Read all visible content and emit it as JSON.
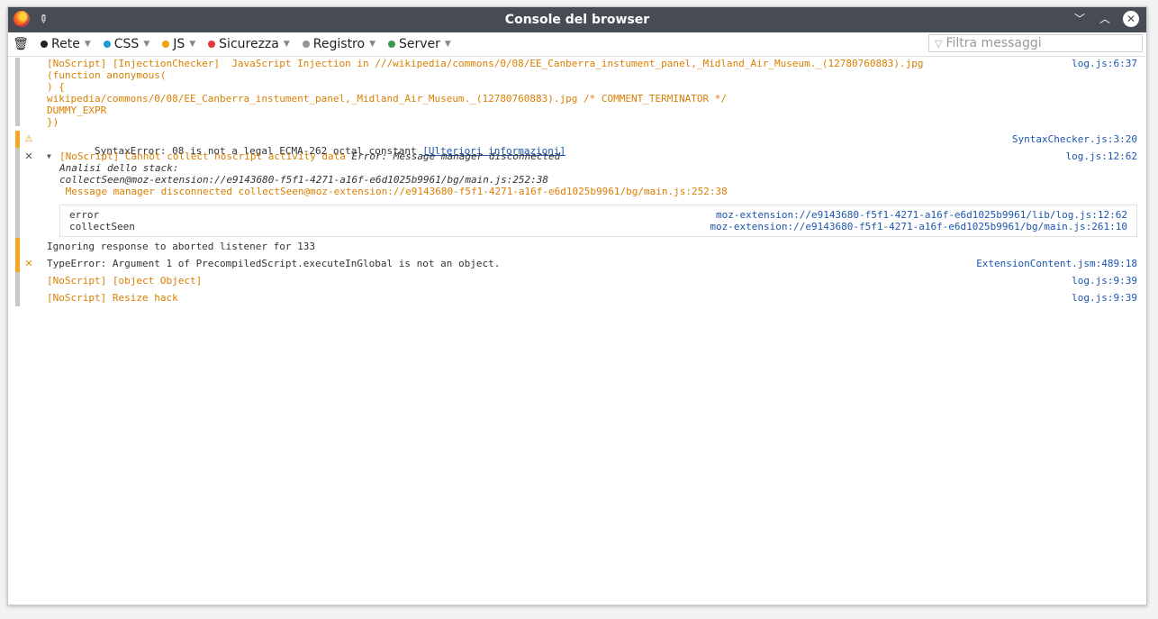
{
  "window": {
    "title": "Console del browser"
  },
  "toolbar": {
    "filters": [
      {
        "label": "Rete",
        "color": "#222222"
      },
      {
        "label": "CSS",
        "color": "#1e9bd7"
      },
      {
        "label": "JS",
        "color": "#f0a30a"
      },
      {
        "label": "Sicurezza",
        "color": "#e0383e"
      },
      {
        "label": "Registro",
        "color": "#8f969a"
      },
      {
        "label": "Server",
        "color": "#3a9b48"
      }
    ],
    "filter_placeholder": "Filtra messaggi"
  },
  "messages": {
    "m1": {
      "lines": [
        "[NoScript] [InjectionChecker]  JavaScript Injection in ///wikipedia/commons/0/08/EE_Canberra_instument_panel,_Midland_Air_Museum._(12780760883).jpg",
        "(function anonymous(",
        ") {",
        "wikipedia/commons/0/08/EE_Canberra_instument_panel,_Midland_Air_Museum._(12780760883).jpg /* COMMENT_TERMINATOR */",
        "DUMMY_EXPR",
        "})"
      ],
      "location": "log.js:6:37"
    },
    "m2": {
      "text": "SyntaxError: 08 is not a legal ECMA-262 octal constant ",
      "link": "[Ulteriori informazioni]",
      "location": "SyntaxChecker.js:3:20"
    },
    "m3": {
      "text": "[NoScript] Cannot collect noscript activity data ",
      "error_text": "Error: Message manager disconnected",
      "stack_header": "Analisi dello stack:",
      "stack_line": "collectSeen@moz-extension://e9143680-f5f1-4271-a16f-e6d1025b9961/bg/main.js:252:38",
      "message_line": " Message manager disconnected collectSeen@moz-extension://e9143680-f5f1-4271-a16f-e6d1025b9961/bg/main.js:252:38",
      "location": "log.js:12:62",
      "stack": [
        {
          "fn": "error",
          "src": "moz-extension://e9143680-f5f1-4271-a16f-e6d1025b9961/lib/log.js:12:62"
        },
        {
          "fn": "collectSeen",
          "src": "moz-extension://e9143680-f5f1-4271-a16f-e6d1025b9961/bg/main.js:261:10"
        }
      ]
    },
    "m4": {
      "text": "Ignoring response to aborted listener for 133"
    },
    "m5": {
      "text": "TypeError: Argument 1 of PrecompiledScript.executeInGlobal is not an object.",
      "location": "ExtensionContent.jsm:489:18"
    },
    "m6": {
      "text": "[NoScript] [object Object]",
      "location": "log.js:9:39"
    },
    "m7": {
      "text": "[NoScript] Resize hack",
      "location": "log.js:9:39"
    }
  }
}
